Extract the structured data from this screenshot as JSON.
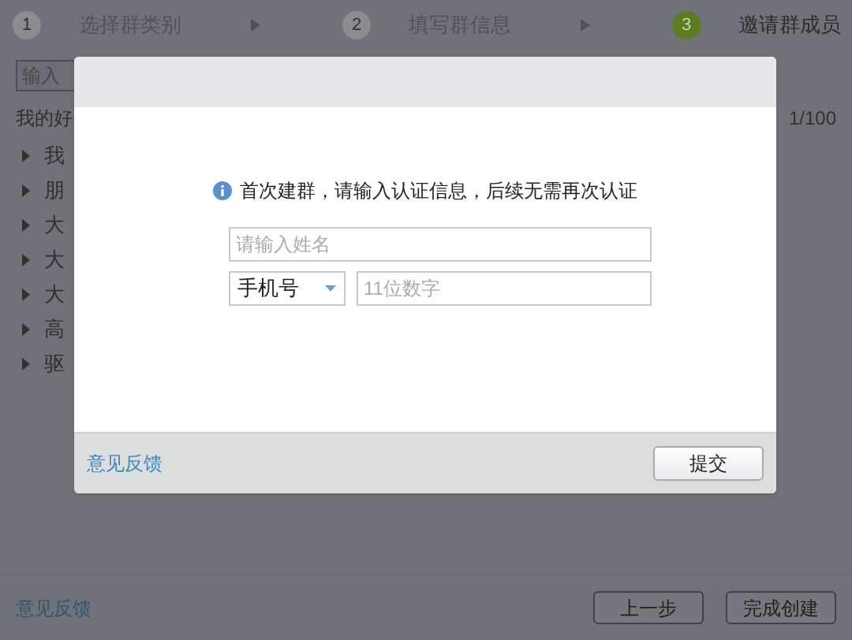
{
  "steps": [
    {
      "number": "1",
      "label": "选择群类别",
      "selected": false
    },
    {
      "number": "2",
      "label": "填写群信息",
      "selected": false
    },
    {
      "number": "3",
      "label": "邀请群成员",
      "selected": true
    }
  ],
  "search": {
    "placeholder": "输入"
  },
  "friends_heading": "我的好",
  "count": "1/100",
  "groups": [
    {
      "label": "我"
    },
    {
      "label": "朋"
    },
    {
      "label": "大"
    },
    {
      "label": "大"
    },
    {
      "label": "大"
    },
    {
      "label": "高"
    },
    {
      "label": "驱"
    }
  ],
  "dialog": {
    "message": "首次建群，请输入认证信息，后续无需再次认证",
    "name_field": {
      "placeholder": "请输入姓名"
    },
    "id_type": {
      "value": "手机号"
    },
    "phone_field": {
      "placeholder": "11位数字"
    },
    "feedback_link": "意见反馈",
    "submit_button": "提交"
  },
  "footer": {
    "feedback_link": "意见反馈",
    "buttons": [
      "上一步",
      "完成创建"
    ]
  }
}
